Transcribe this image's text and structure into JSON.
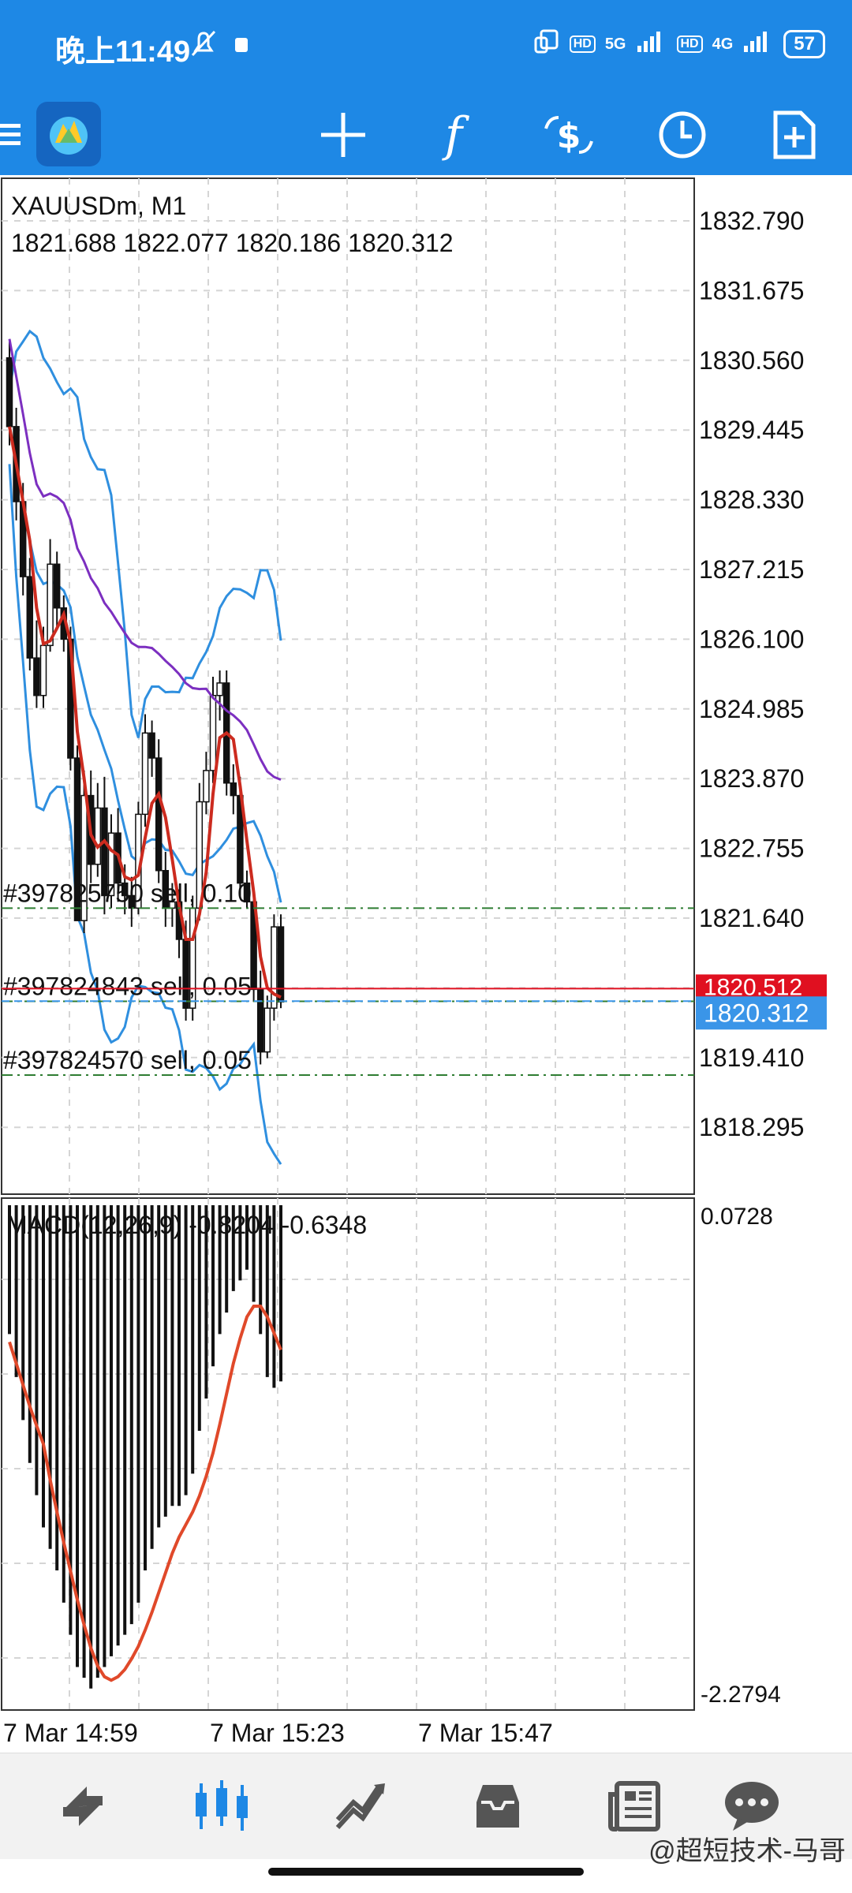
{
  "status_bar": {
    "time": "晚上11:49",
    "network1": "5G",
    "network2": "4G",
    "hd": "HD",
    "battery": "57"
  },
  "toolbar": {
    "icons": [
      "menu-icon",
      "mt5-logo",
      "crosshair-icon",
      "indicators-icon",
      "trade-icon",
      "timeframe-icon",
      "new-order-icon"
    ],
    "crosshair_symbol": "+",
    "function_symbol": "f"
  },
  "chart": {
    "symbol_header": "XAUUSDm, M1",
    "ohlc_header": "1821.688 1822.077 1820.186 1820.312",
    "price_axis": [
      "1832.790",
      "1831.675",
      "1830.560",
      "1829.445",
      "1828.330",
      "1827.215",
      "1826.100",
      "1824.985",
      "1823.870",
      "1822.755",
      "1821.640",
      "1819.410",
      "1818.295"
    ],
    "current_price": "1820.312",
    "red_price": "1820.512",
    "orders": [
      {
        "label": "#397825750 sell, 0.10",
        "price": 1821.8
      },
      {
        "label": "#397824843 sell, 0.05",
        "price": 1820.31
      },
      {
        "label": "#397824570 sell, 0.05",
        "price": 1819.13
      }
    ],
    "time_axis": [
      "7 Mar 14:59",
      "7 Mar 15:23",
      "7 Mar 15:47"
    ],
    "colors": {
      "bollinger": "#2f8fdf",
      "ma_red": "#cc2b1f",
      "ma_purple": "#7c2fc0",
      "bid_line": "#e01020",
      "ask_badge": "#3a95e8",
      "order_line": "#2e7d32"
    }
  },
  "macd": {
    "label": "MACD(12,26,9) -0.8204 -0.6348",
    "axis_top": "0.0728",
    "axis_bottom": "-2.2794",
    "signal_color": "#e0492a"
  },
  "bottom_nav": {
    "items": [
      "quotes-icon",
      "chart-icon",
      "trade-icon",
      "history-icon",
      "news-icon",
      "messages-icon"
    ],
    "active_index": 1
  },
  "watermark": "@超短技术-马哥"
}
